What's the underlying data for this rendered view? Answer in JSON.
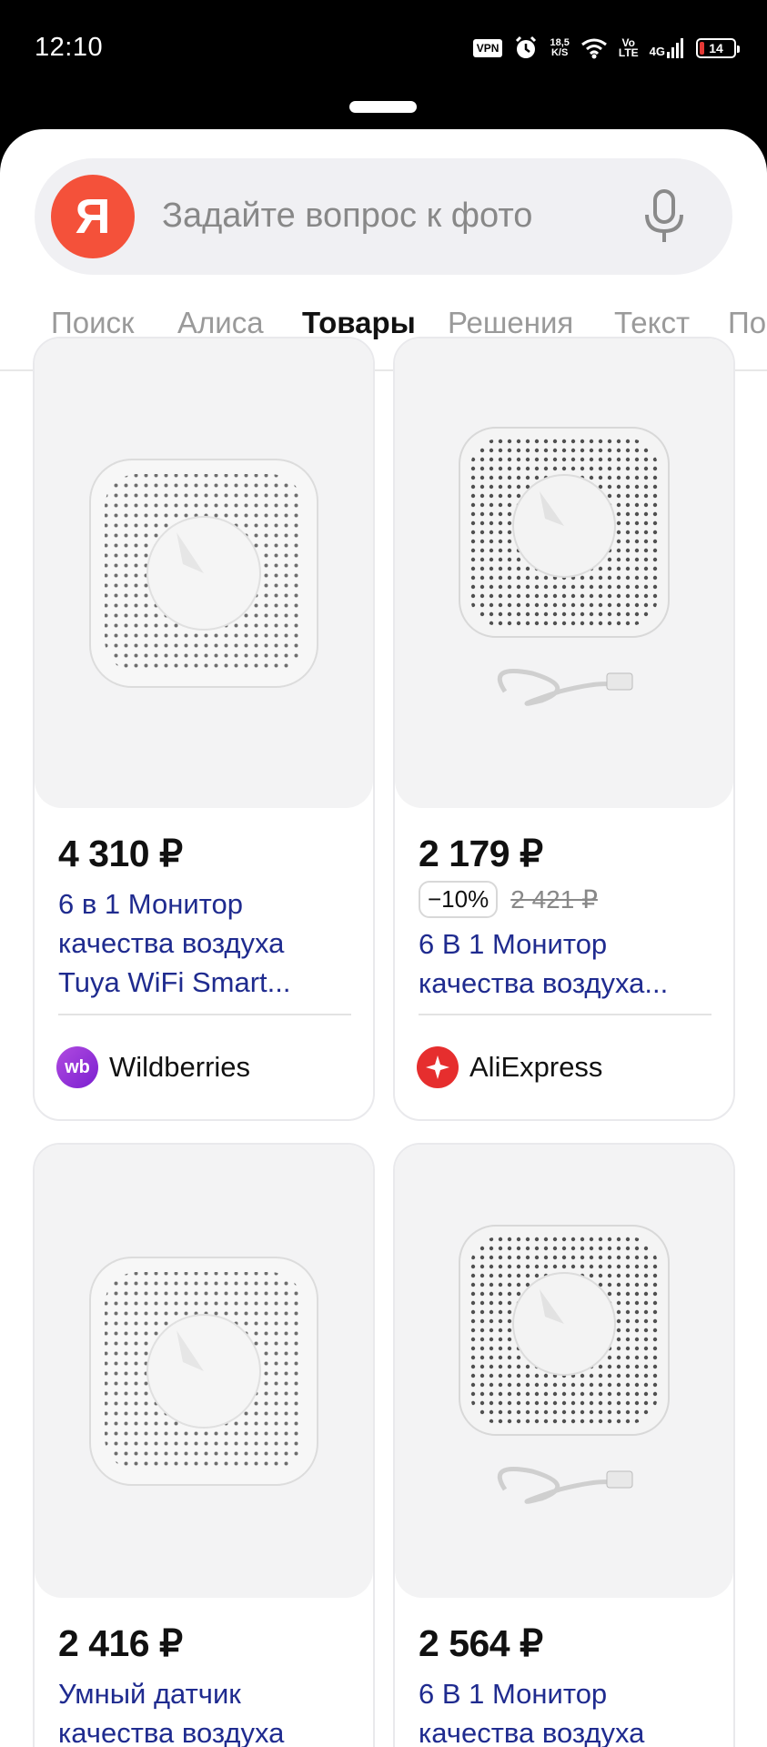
{
  "status": {
    "time": "12:10",
    "vpn": "VPN",
    "speed_value": "18,5",
    "speed_unit": "K/S",
    "volte_top": "Vo",
    "volte_bottom": "LTE",
    "network": "4G",
    "battery": "14",
    "battery_level": 0.14
  },
  "search": {
    "logo": "Я",
    "placeholder": "Задайте вопрос к фото",
    "mic_icon": "microphone-icon"
  },
  "tabs": [
    {
      "label": "Поиск",
      "active": false
    },
    {
      "label": "Алиса",
      "active": false
    },
    {
      "label": "Товары",
      "active": true
    },
    {
      "label": "Решения",
      "active": false
    },
    {
      "label": "Текст",
      "active": false
    },
    {
      "label": "По",
      "active": false
    }
  ],
  "products": [
    {
      "price": "4 310 ₽",
      "title_lines": [
        "6 в 1 Монитор",
        "качества воздуха",
        "Tuya WiFi Smart..."
      ],
      "store": "Wildberries",
      "store_logo": "wb",
      "store_color": "#8e2de2"
    },
    {
      "price": "2 179 ₽",
      "discount": "−10%",
      "old_price": "2 421 ₽",
      "title_lines": [
        "6 В 1 Монитор",
        "качества воздуха..."
      ],
      "store": "AliExpress",
      "store_logo": "aliexpress-star-icon",
      "store_color": "#e62e2e"
    },
    {
      "price": "2 416 ₽",
      "title_lines": [
        "Умный датчик",
        "качества воздуха"
      ]
    },
    {
      "price": "2 564 ₽",
      "title_lines": [
        "6 В 1 Монитор",
        "качества воздуха"
      ]
    }
  ],
  "colors": {
    "yandex_red": "#f4513a",
    "link_blue": "#1f2b8f",
    "wildberries": "#8e2de2",
    "aliexpress": "#e62e2e"
  }
}
